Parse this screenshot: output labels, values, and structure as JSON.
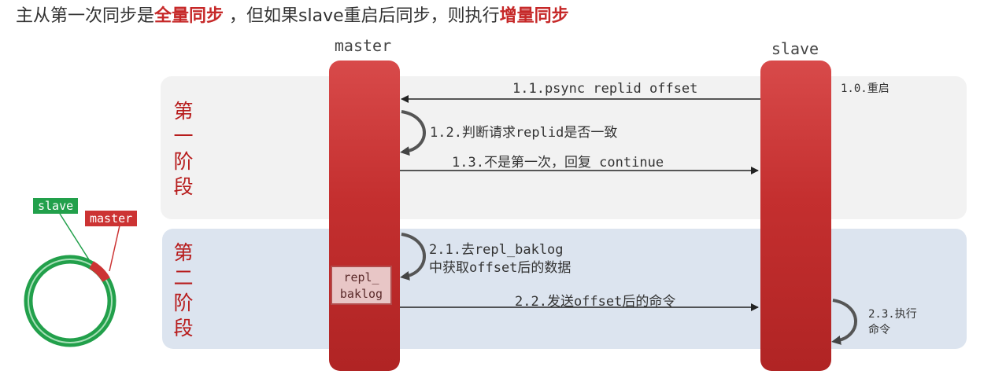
{
  "title": {
    "part1": "主从第一次同步是",
    "highlight1": "全量同步",
    "part2": " ，但如果slave重启后同步，则执行",
    "highlight2": "增量同步"
  },
  "actors": {
    "master": "master",
    "slave": "slave"
  },
  "phases": [
    {
      "chars": [
        "第",
        "一",
        "阶",
        "段"
      ]
    },
    {
      "chars": [
        "第",
        "二",
        "阶",
        "段"
      ]
    }
  ],
  "steps": {
    "s1_0": "1.0.重启",
    "s1_1": "1.1.psync replid offset",
    "s1_2": "1.2.判断请求replid是否一致",
    "s1_3": "1.3.不是第一次，回复 continue",
    "s2_1_line1": "2.1.去repl_baklog",
    "s2_1_line2": "中获取offset后的数据",
    "s2_2": "2.2.发送offset后的命令",
    "s2_3_line1": "2.3.执行",
    "s2_3_line2": "命令"
  },
  "backlog": {
    "line1": "repl_",
    "line2": "baklog"
  },
  "ring": {
    "slave_tag": "slave",
    "master_tag": "master"
  },
  "colors": {
    "highlight": "#c62828",
    "lifeline": "#c42f2f",
    "phase1_bg": "#f2f2f2",
    "phase2_bg": "#dce4ef",
    "ring_green": "#22a04b",
    "ring_red": "#cc3333"
  }
}
